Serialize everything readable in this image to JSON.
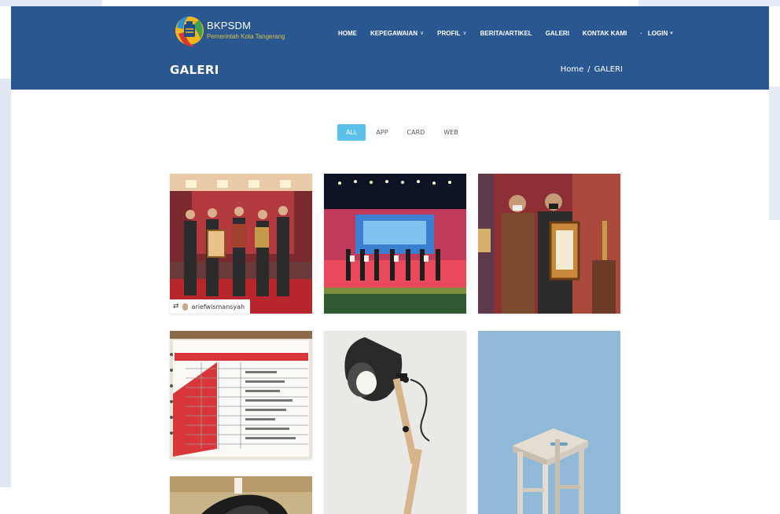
{
  "site": {
    "logo_title": "BKPSDM",
    "logo_subtitle": "Pemerintah Kota Tangerang"
  },
  "nav": {
    "items": [
      {
        "label": "HOME",
        "caret": ""
      },
      {
        "label": "KEPEGAWAIAN",
        "caret": "∨"
      },
      {
        "label": "PROFIL",
        "caret": "∨"
      },
      {
        "label": "BERITA/ARTIKEL",
        "caret": ""
      },
      {
        "label": "GALERI",
        "caret": ""
      },
      {
        "label": "KONTAK KAMI",
        "caret": ""
      }
    ],
    "login": {
      "label": "LOGIN",
      "prefix": "·",
      "suffix": "▾"
    }
  },
  "page": {
    "title": "GALERI",
    "breadcrumb": {
      "home": "Home",
      "separator": "/",
      "current": "GALERI"
    }
  },
  "filters": [
    {
      "label": "ALL",
      "active": true
    },
    {
      "label": "APP",
      "active": false
    },
    {
      "label": "CARD",
      "active": false
    },
    {
      "label": "WEB",
      "active": false
    }
  ],
  "gallery": {
    "items": [
      {
        "name": "award-ceremony-photo",
        "credit": "ariefwismansyah"
      },
      {
        "name": "stage-event-photo"
      },
      {
        "name": "award-recipients-photo"
      },
      {
        "name": "document-list-photo"
      },
      {
        "name": "desk-lamp-photo"
      },
      {
        "name": "wooden-stool-photo"
      },
      {
        "name": "camera-lens-photo"
      }
    ]
  },
  "colors": {
    "header_bg": "#2b5791",
    "filter_active": "#5bc0eb",
    "page_bg": "#ffffff"
  }
}
